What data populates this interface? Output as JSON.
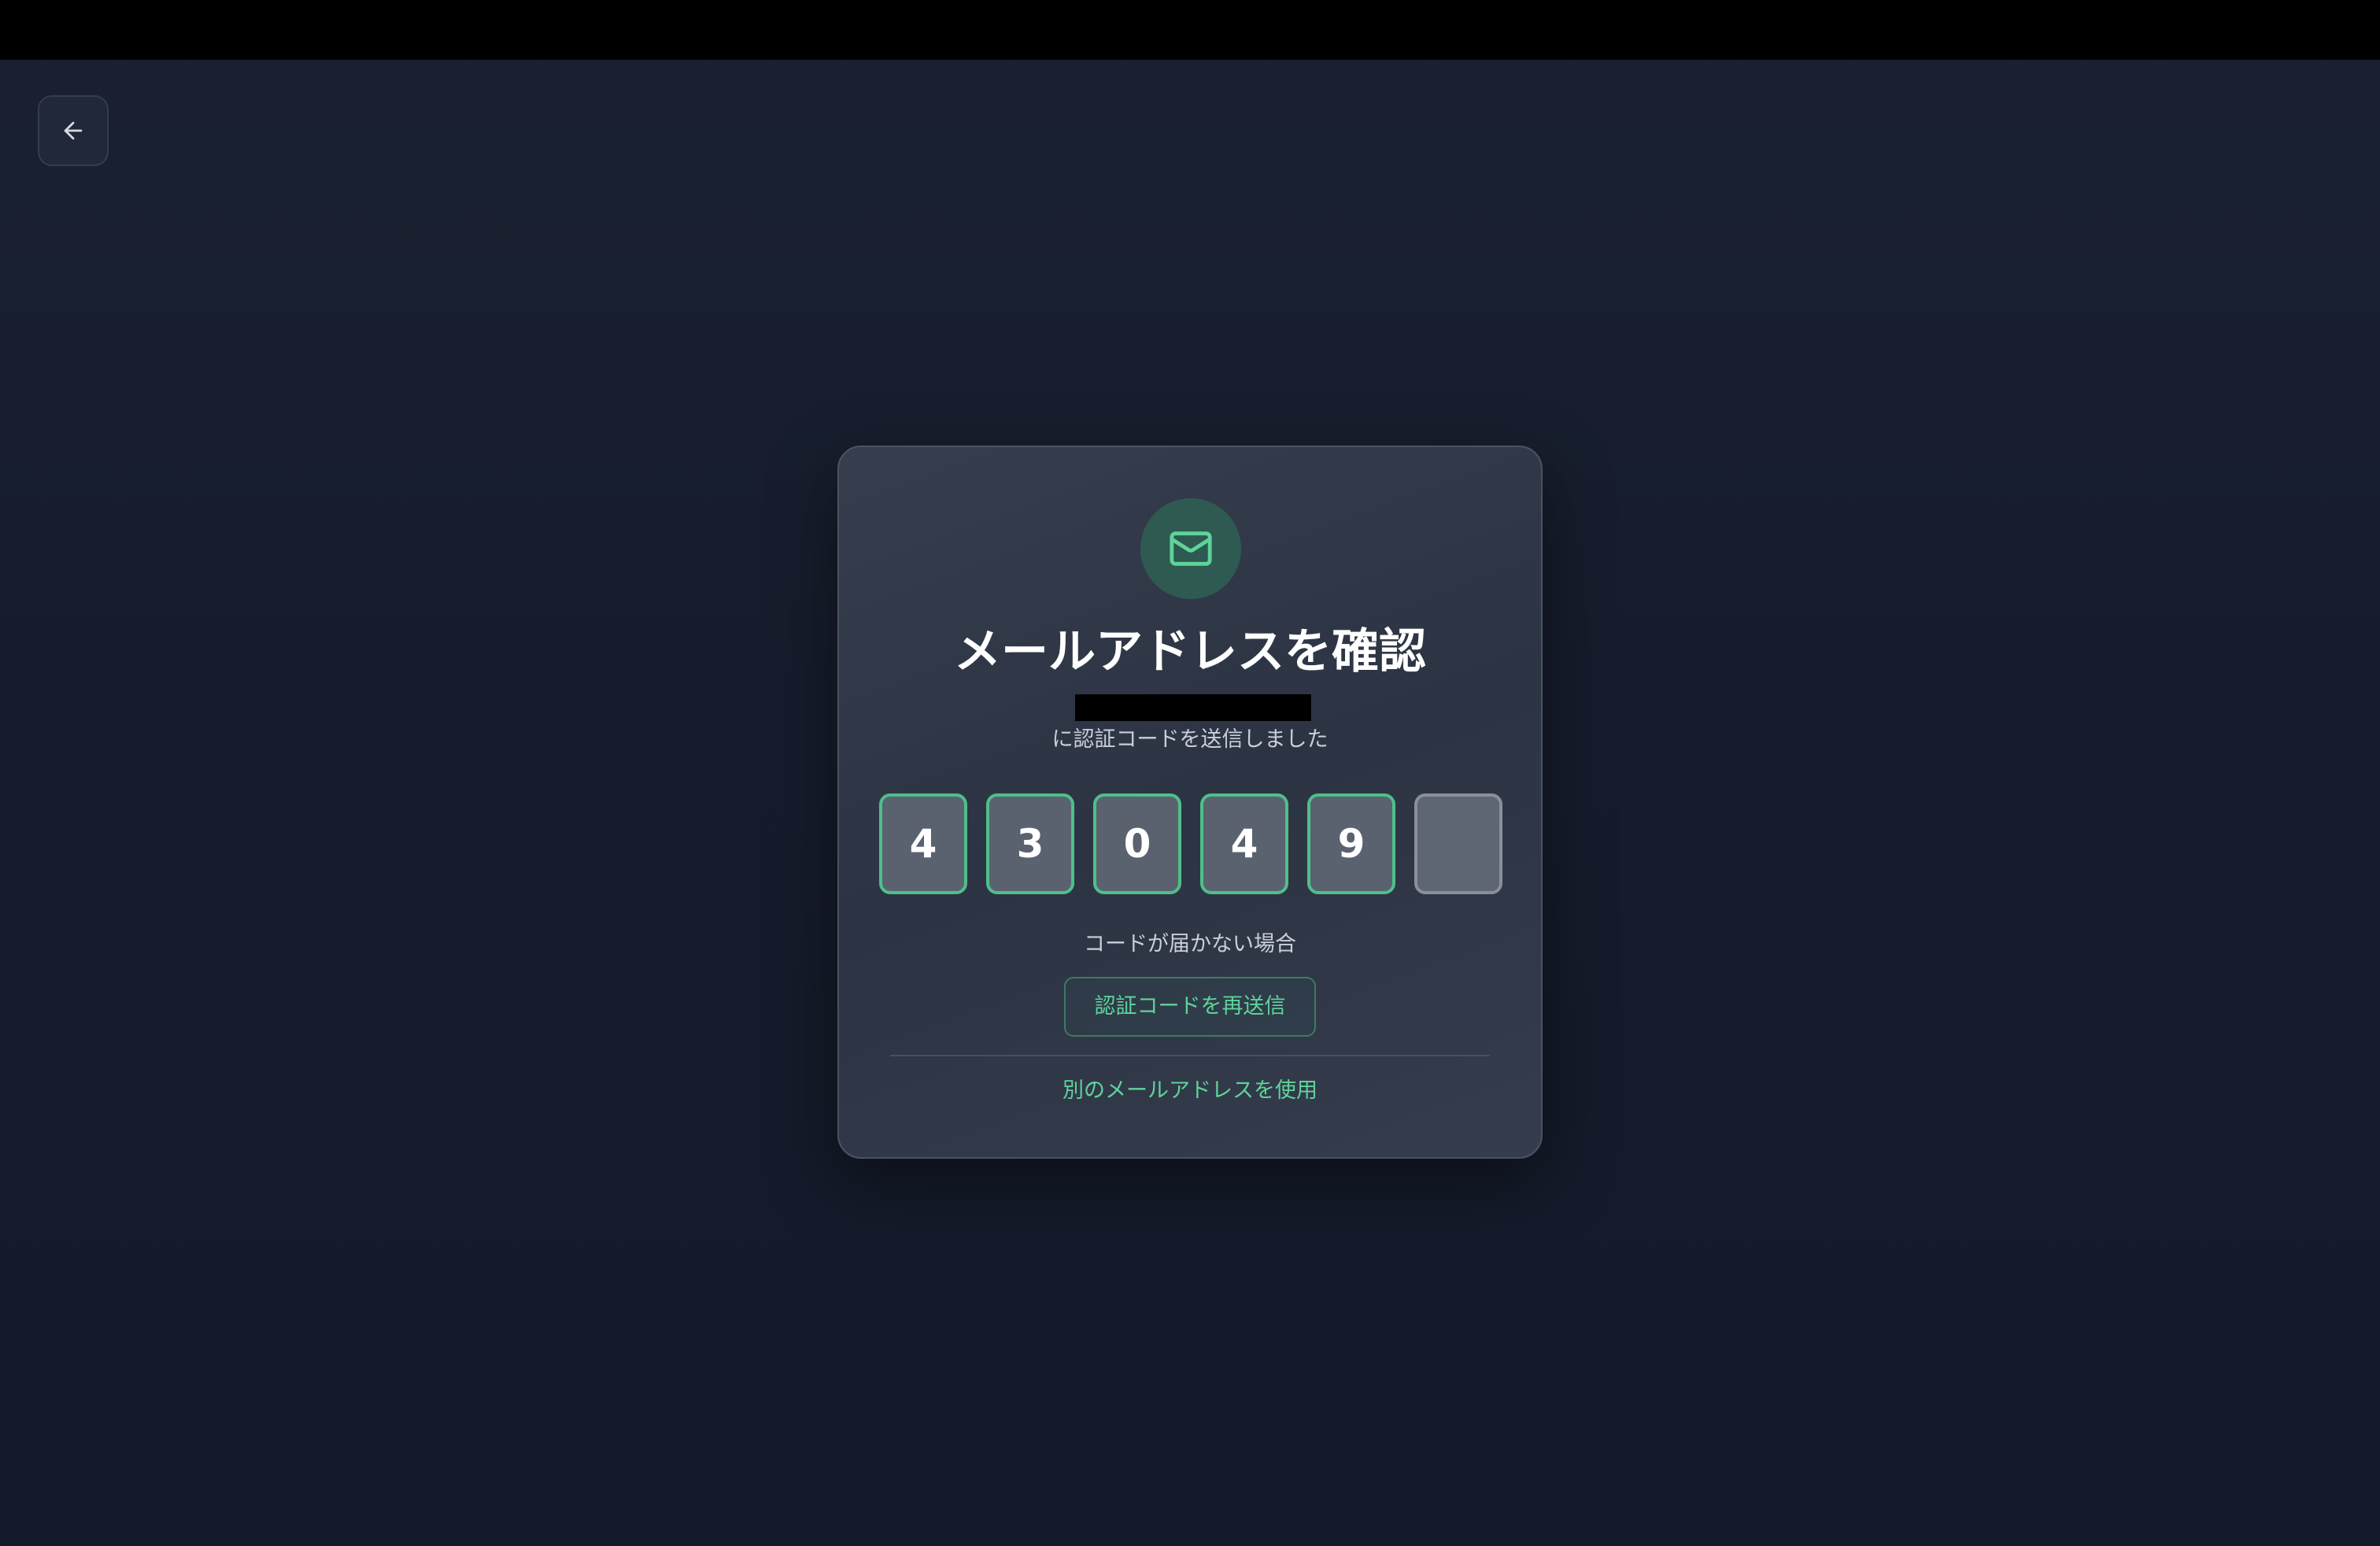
{
  "icons": {
    "back": "arrow-left-icon",
    "mail": "mail-icon"
  },
  "colors": {
    "accent": "#5fd39a",
    "background": "#161c2c",
    "card": "#313949"
  },
  "verify": {
    "title": "メールアドレスを確認",
    "sent_message": "に認証コードを送信しました",
    "code_digits": [
      "4",
      "3",
      "0",
      "4",
      "9",
      ""
    ],
    "no_code_text": "コードが届かない場合",
    "resend_label": "認証コードを再送信",
    "other_email_label": "別のメールアドレスを使用"
  }
}
